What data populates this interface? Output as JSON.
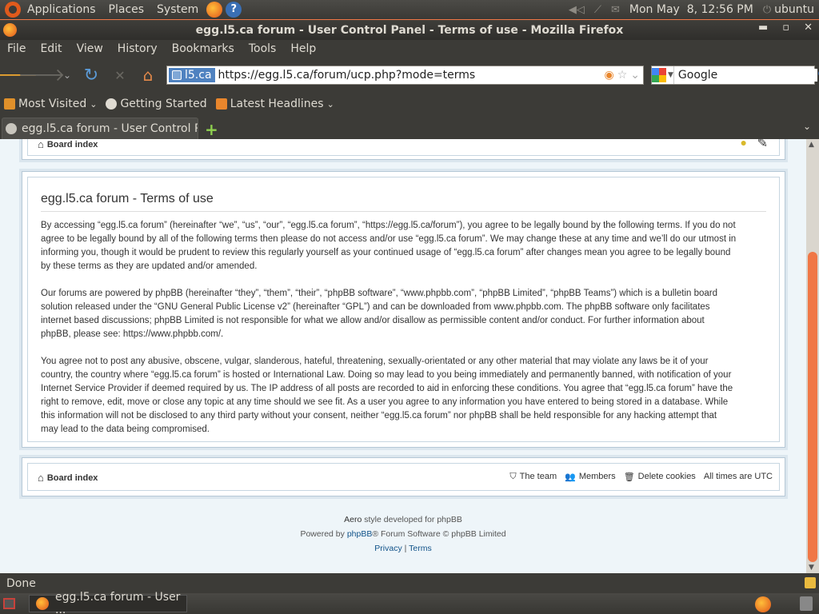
{
  "gnome_panel": {
    "menus": [
      "Applications",
      "Places",
      "System"
    ],
    "clock": "Mon May  8, 12:56 PM",
    "user": "ubuntu"
  },
  "window": {
    "title": "egg.l5.ca forum - User Control Panel - Terms of use - Mozilla Firefox"
  },
  "menubar": [
    "File",
    "Edit",
    "View",
    "History",
    "Bookmarks",
    "Tools",
    "Help"
  ],
  "navbar": {
    "identity": "l5.ca",
    "url": "https://egg.l5.ca/forum/ucp.php?mode=terms",
    "search_value": "Google"
  },
  "bookmarks": [
    {
      "label": "Most Visited",
      "dropdown": true,
      "icon_color": "#e0902a"
    },
    {
      "label": "Getting Started",
      "dropdown": false,
      "icon_color": "#dfdbd2"
    },
    {
      "label": "Latest Headlines",
      "dropdown": true,
      "icon_color": "#e9862c"
    }
  ],
  "tab": {
    "label": "egg.l5.ca forum - User Control P..."
  },
  "page": {
    "top_nav": {
      "board_index": "Board index"
    },
    "terms": {
      "title": "egg.l5.ca forum - Terms of use",
      "p1_lines": [
        "By accessing “egg.l5.ca forum” (hereinafter “we”, “us”, “our”, “egg.l5.ca forum”, “https://egg.l5.ca/forum”), you agree to be legally bound by the following terms. If you do not",
        "agree to be legally bound by all of the following terms then please do not access and/or use “egg.l5.ca forum”. We may change these at any time and we’ll do our utmost in",
        "informing you, though it would be prudent to review this regularly yourself as your continued usage of “egg.l5.ca forum” after changes mean you agree to be legally bound",
        "by these terms as they are updated and/or amended."
      ],
      "p2_lines": [
        "Our forums are powered by phpBB (hereinafter “they”, “them”, “their”, “phpBB software”, “www.phpbb.com”, “phpBB Limited”, “phpBB Teams”) which is a bulletin board",
        "solution released under the “GNU General Public License v2” (hereinafter “GPL”) and can be downloaded from www.phpbb.com. The phpBB software only facilitates",
        "internet based discussions; phpBB Limited is not responsible for what we allow and/or disallow as permissible content and/or conduct. For further information about",
        "phpBB, please see: https://www.phpbb.com/."
      ],
      "p3_lines": [
        "You agree not to post any abusive, obscene, vulgar, slanderous, hateful, threatening, sexually-orientated or any other material that may violate any laws be it of your",
        "country, the country where “egg.l5.ca forum” is hosted or International Law. Doing so may lead to you being immediately and permanently banned, with notification of your",
        "Internet Service Provider if deemed required by us. The IP address of all posts are recorded to aid in enforcing these conditions. You agree that “egg.l5.ca forum” have the",
        "right to remove, edit, move or close any topic at any time should we see fit. As a user you agree to any information you have entered to being stored in a database. While",
        "this information will not be disclosed to any third party without your consent, neither “egg.l5.ca forum” nor phpBB shall be held responsible for any hacking attempt that",
        "may lead to the data being compromised."
      ]
    },
    "footer_nav": {
      "board_index": "Board index",
      "the_team": "The team",
      "members": "Members",
      "delete_cookies": "Delete cookies",
      "timezone": "All times are UTC"
    },
    "credits": {
      "style_name": "Aero",
      "style_suffix": " style developed for phpBB",
      "powered_prefix": "Powered by ",
      "phpbb": "phpBB",
      "powered_suffix": "® Forum Software © phpBB Limited",
      "privacy": "Privacy",
      "separator": " | ",
      "terms": "Terms"
    }
  },
  "statusbar": {
    "text": "Done"
  },
  "taskbar": {
    "task_label": "egg.l5.ca forum - User ..."
  }
}
